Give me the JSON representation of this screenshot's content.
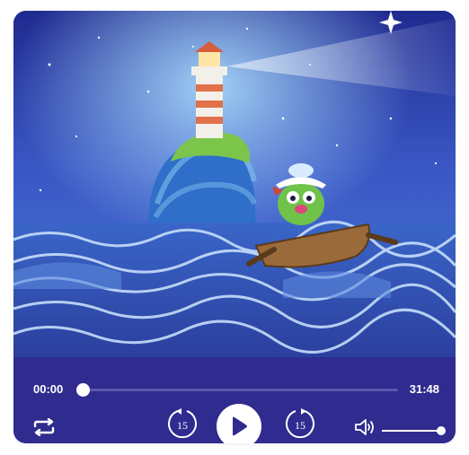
{
  "player": {
    "current_time": "00:00",
    "total_time": "31:48",
    "progress_fraction": 0.0,
    "volume_fraction": 1.0,
    "skip_back_seconds": "15",
    "skip_forward_seconds": "15"
  },
  "icons": {
    "repeat": "repeat-icon",
    "rewind": "rewind-15-icon",
    "play": "play-icon",
    "forward": "forward-15-icon",
    "volume": "volume-icon"
  },
  "colors": {
    "control_bar": "#2f2b8f",
    "accent": "#ffffff",
    "play_triangle": "#2f2b8f"
  }
}
